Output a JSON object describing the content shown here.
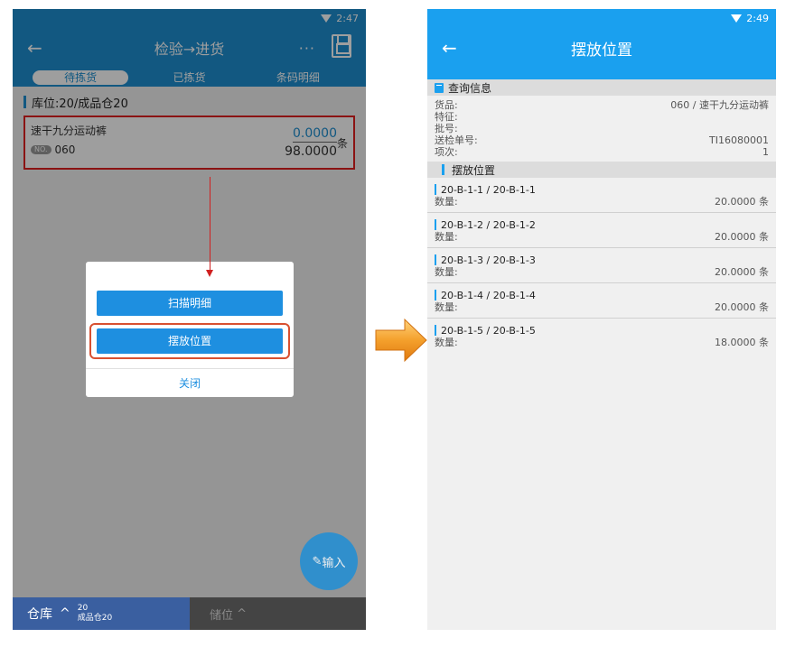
{
  "left_phone": {
    "status_time": "2:47",
    "title": "检验→进货",
    "more": "···",
    "tabs": [
      "待拣货",
      "已拣货",
      "条码明细"
    ],
    "section_title": "库位:20/成品仓20",
    "item": {
      "name": "速干九分运动裤",
      "badge": "NO.",
      "code": "060",
      "qty_picked": "0.0000",
      "qty_total": "98.0000",
      "unit": "条"
    },
    "dialog": {
      "scan_detail": "扫描明细",
      "placement": "摆放位置",
      "close": "关闭"
    },
    "fab_label": "输入",
    "bottom": {
      "warehouse_label": "仓库",
      "warehouse_code": "20",
      "warehouse_name": "成品仓20",
      "location_label": "储位"
    }
  },
  "right_phone": {
    "status_time": "2:49",
    "title": "摆放位置",
    "query_section": "查询信息",
    "info": [
      {
        "label": "货品:",
        "value": "060 / 速干九分运动裤"
      },
      {
        "label": "特征:",
        "value": ""
      },
      {
        "label": "批号:",
        "value": ""
      },
      {
        "label": "送检单号:",
        "value": "TI16080001"
      },
      {
        "label": "项次:",
        "value": "1"
      }
    ],
    "placement_section": "摆放位置",
    "locations": [
      {
        "name": "20-B-1-1 / 20-B-1-1",
        "qty_label": "数量:",
        "qty": "20.0000 条"
      },
      {
        "name": "20-B-1-2 / 20-B-1-2",
        "qty_label": "数量:",
        "qty": "20.0000 条"
      },
      {
        "name": "20-B-1-3 / 20-B-1-3",
        "qty_label": "数量:",
        "qty": "20.0000 条"
      },
      {
        "name": "20-B-1-4 / 20-B-1-4",
        "qty_label": "数量:",
        "qty": "20.0000 条"
      },
      {
        "name": "20-B-1-5 / 20-B-1-5",
        "qty_label": "数量:",
        "qty": "18.0000 条"
      }
    ]
  },
  "colors": {
    "left_primary": "#1d8fd1",
    "right_primary": "#1aa0ef",
    "highlight_red": "#e02020",
    "arrow_orange": "#f0a040"
  }
}
